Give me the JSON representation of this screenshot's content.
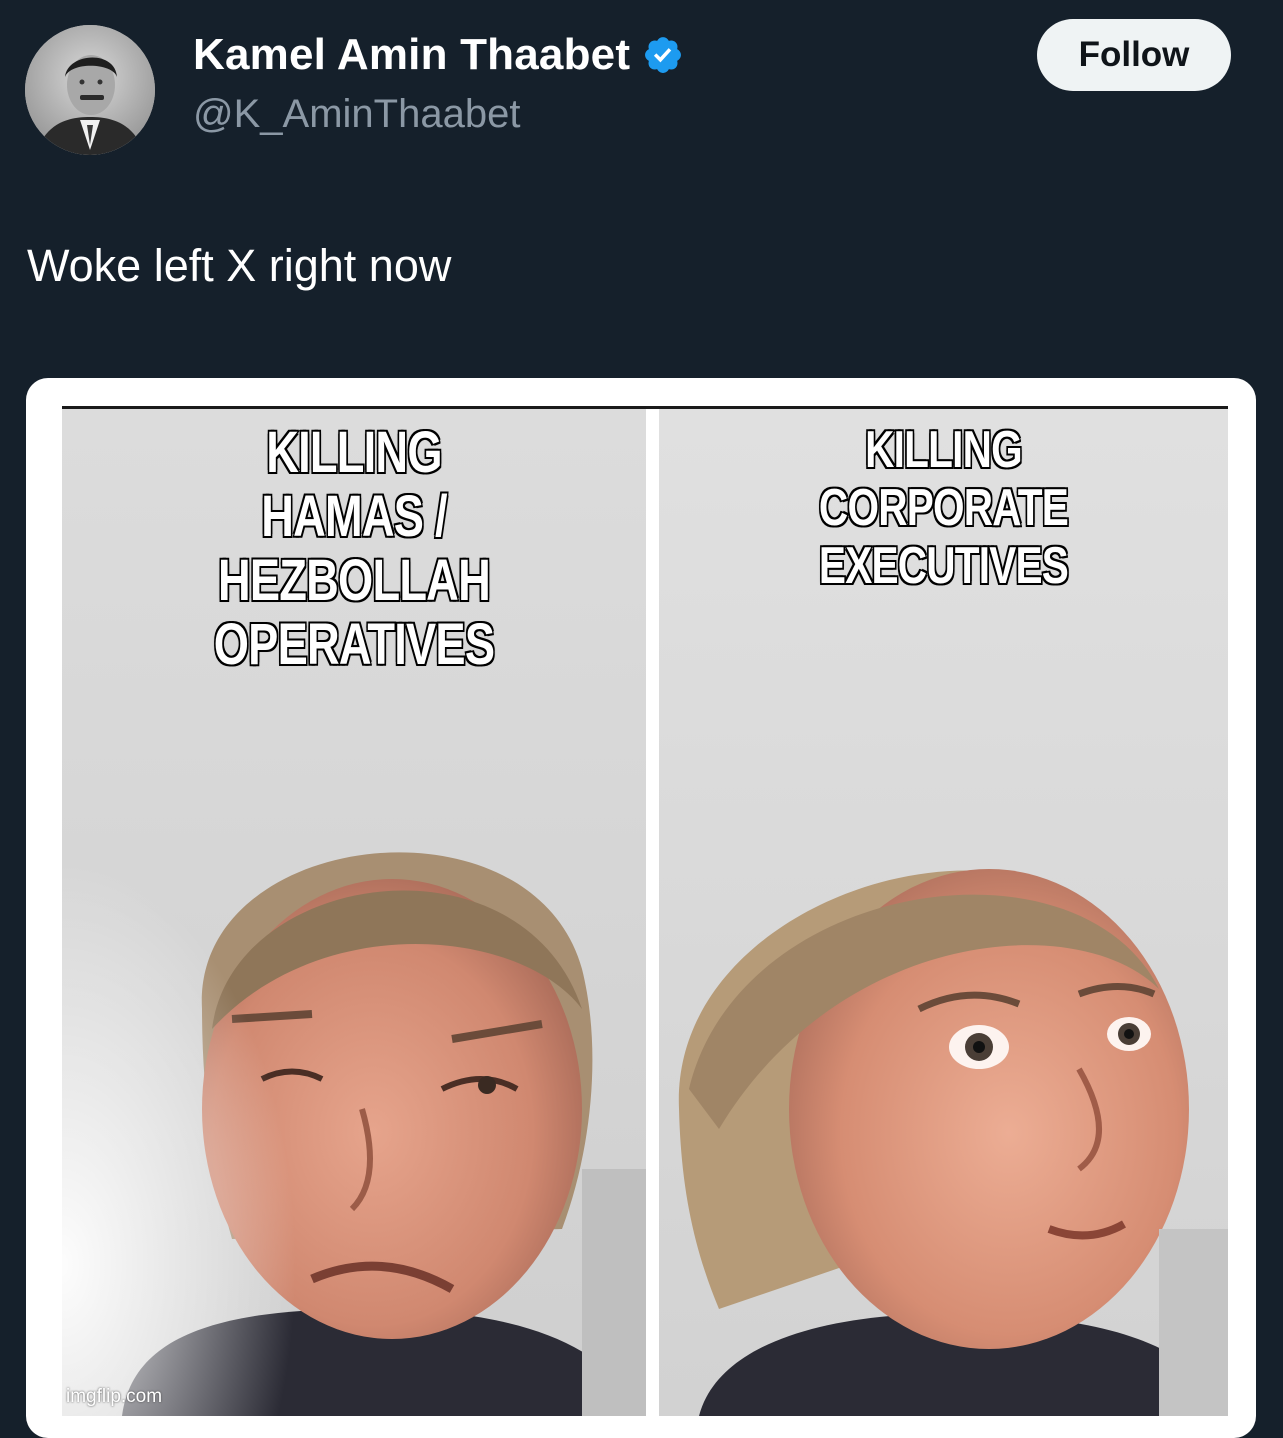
{
  "author": {
    "display_name": "Kamel Amin Thaabet",
    "handle": "@K_AminThaabet",
    "verified_icon": "verified-badge-icon",
    "avatar": "profile-photo"
  },
  "follow_button": {
    "label": "Follow"
  },
  "tweet": {
    "text": "Woke left X right now"
  },
  "meme": {
    "left_caption": [
      "KILLING",
      "HAMAS / HEZBOLLAH",
      "OPERATIVES"
    ],
    "right_caption": [
      "KILLING",
      "CORPORATE EXECUTIVES"
    ],
    "watermark": "imgflip.com"
  },
  "colors": {
    "background": "#15202b",
    "accent": "#1d9bf0",
    "secondary_text": "#8b98a5",
    "button_bg": "#eff3f4"
  }
}
